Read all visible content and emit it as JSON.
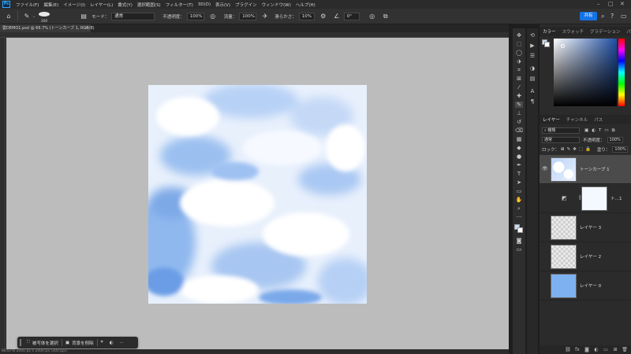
{
  "app": {
    "logo_text": "Ps",
    "menu": [
      "ファイル(F)",
      "編集(E)",
      "イメージ(I)",
      "レイヤー(L)",
      "書式(Y)",
      "選択範囲(S)",
      "フィルター(T)",
      "3D(D)",
      "表示(V)",
      "プラグイン",
      "ウィンドウ(W)",
      "ヘルプ(H)"
    ]
  },
  "options": {
    "brush_size": "300",
    "mode_label": "モード：",
    "mode_value": "通常",
    "opacity_label": "不透明度：",
    "opacity_value": "100%",
    "flow_label": "流量：",
    "flow_value": "100%",
    "smoothing_label": "滑らかさ：",
    "smoothing_value": "10%",
    "angle_value": "0°",
    "share_label": "共有"
  },
  "document": {
    "tab_title": "雲DEMO1.psd @ 66.7% (トーンカーブ 1, RGB/8)",
    "tab_close": "×",
    "status_text": "66.67%    2000 px x 2000 px (300 ppi)"
  },
  "taskbar": {
    "select_subject": "被写体を選択",
    "remove_background": "背景を削除",
    "more": "···"
  },
  "colors": {
    "tabs": [
      "カラー",
      "スウォッチ",
      "グラデーション",
      "パターン"
    ],
    "foreground": "#c9daf5",
    "background": "#ffffff"
  },
  "layers": {
    "tabs": [
      "レイヤー",
      "チャンネル",
      "パス"
    ],
    "filter_kind": "種類",
    "blend_mode": "通常",
    "opacity_label": "不透明度：",
    "opacity_value": "100%",
    "lock_label": "ロック：",
    "fill_label": "塗り：",
    "fill_value": "100%",
    "items": [
      {
        "name": "トーンカーブ 1",
        "visible": true,
        "selected": true,
        "thumb": "cloud"
      },
      {
        "name": "ト…1",
        "visible": false,
        "selected": false,
        "thumb": "white"
      },
      {
        "name": "レイヤー 3",
        "visible": false,
        "selected": false,
        "thumb": "transparent"
      },
      {
        "name": "レイヤー 2",
        "visible": false,
        "selected": false,
        "thumb": "transparent"
      },
      {
        "name": "レイヤー 0",
        "visible": false,
        "selected": false,
        "thumb": "blue"
      }
    ]
  }
}
